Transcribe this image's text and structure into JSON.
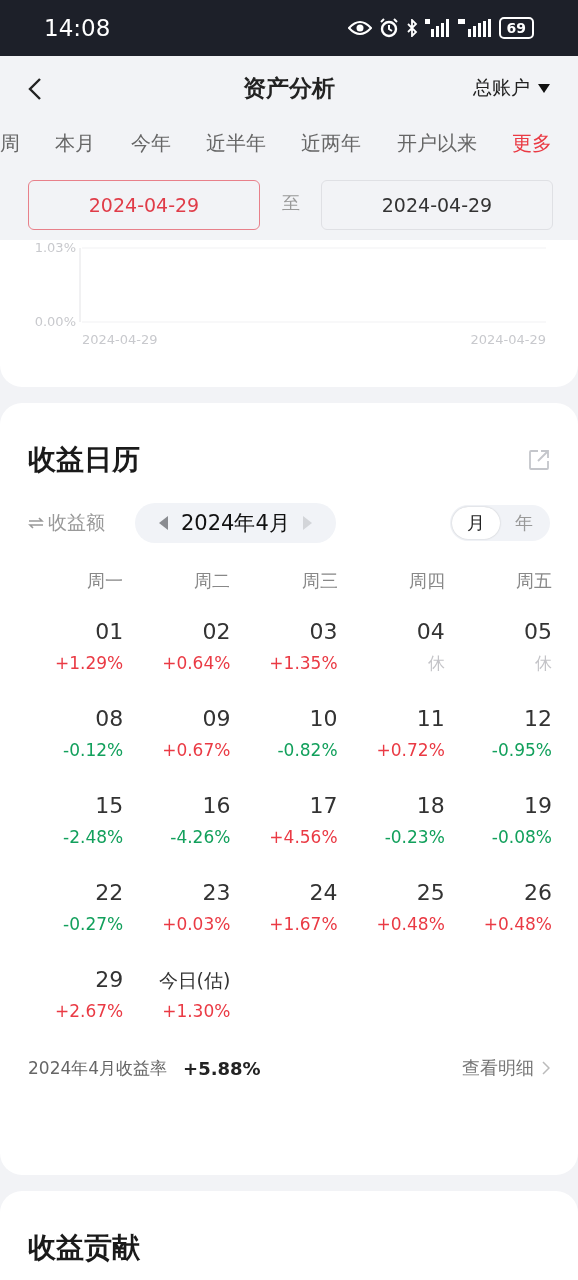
{
  "status_bar": {
    "time": "14:08",
    "battery": "69"
  },
  "header": {
    "title": "资产分析",
    "account": "总账户"
  },
  "period_tabs": [
    {
      "label": "周",
      "selected": false,
      "kind": "period"
    },
    {
      "label": "本月",
      "selected": false,
      "kind": "period"
    },
    {
      "label": "今年",
      "selected": false,
      "kind": "period"
    },
    {
      "label": "近半年",
      "selected": false,
      "kind": "period"
    },
    {
      "label": "近两年",
      "selected": false,
      "kind": "period"
    },
    {
      "label": "开户以来",
      "selected": false,
      "kind": "period"
    },
    {
      "label": "更多",
      "selected": false,
      "kind": "more"
    }
  ],
  "date_range": {
    "start": {
      "value": "2024-04-29",
      "selected": true
    },
    "separator": "至",
    "end": {
      "value": "2024-04-29",
      "selected": false
    }
  },
  "chart": {
    "chart_data": {
      "type": "line",
      "categories": [
        "2024-04-29",
        "2024-04-29"
      ],
      "ylim": [
        0,
        1.03
      ],
      "yticks": [
        {
          "value": 1.03,
          "label": "1.03%"
        },
        {
          "value": 0,
          "label": "0.00%"
        }
      ]
    }
  },
  "calendar": {
    "title": "收益日历",
    "metric_toggle": "收益额",
    "month": "2024年4月",
    "view_tabs": [
      {
        "label": "月",
        "selected": true
      },
      {
        "label": "年",
        "selected": false
      }
    ],
    "weekdays": [
      "周一",
      "周二",
      "周三",
      "周四",
      "周五"
    ],
    "days": [
      {
        "day": "01",
        "value": "+1.29%",
        "color": "#ea3a44"
      },
      {
        "day": "02",
        "value": "+0.64%",
        "color": "#ea3a44"
      },
      {
        "day": "03",
        "value": "+1.35%",
        "color": "#ea3a44"
      },
      {
        "day": "04",
        "value": "休",
        "color": "#c4c4c8"
      },
      {
        "day": "05",
        "value": "休",
        "color": "#c4c4c8"
      },
      {
        "day": "08",
        "value": "-0.12%",
        "color": "#12a05c"
      },
      {
        "day": "09",
        "value": "+0.67%",
        "color": "#ea3a44"
      },
      {
        "day": "10",
        "value": "-0.82%",
        "color": "#12a05c"
      },
      {
        "day": "11",
        "value": "+0.72%",
        "color": "#ea3a44"
      },
      {
        "day": "12",
        "value": "-0.95%",
        "color": "#12a05c"
      },
      {
        "day": "15",
        "value": "-2.48%",
        "color": "#12a05c"
      },
      {
        "day": "16",
        "value": "-4.26%",
        "color": "#12a05c"
      },
      {
        "day": "17",
        "value": "+4.56%",
        "color": "#ea3a44"
      },
      {
        "day": "18",
        "value": "-0.23%",
        "color": "#12a05c"
      },
      {
        "day": "19",
        "value": "-0.08%",
        "color": "#12a05c"
      },
      {
        "day": "22",
        "value": "-0.27%",
        "color": "#12a05c"
      },
      {
        "day": "23",
        "value": "+0.03%",
        "color": "#ea3a44"
      },
      {
        "day": "24",
        "value": "+1.67%",
        "color": "#ea3a44"
      },
      {
        "day": "25",
        "value": "+0.48%",
        "color": "#ea3a44"
      },
      {
        "day": "26",
        "value": "+0.48%",
        "color": "#ea3a44"
      },
      {
        "day": "29",
        "value": "+2.67%",
        "color": "#ea3a44"
      },
      {
        "day": "今日(估)",
        "value": "+1.30%",
        "color": "#ea3a44"
      }
    ],
    "summary_label": "2024年4月收益率",
    "summary_value": "+5.88%",
    "detail_link": "查看明细"
  },
  "contribution": {
    "title": "收益贡献"
  }
}
